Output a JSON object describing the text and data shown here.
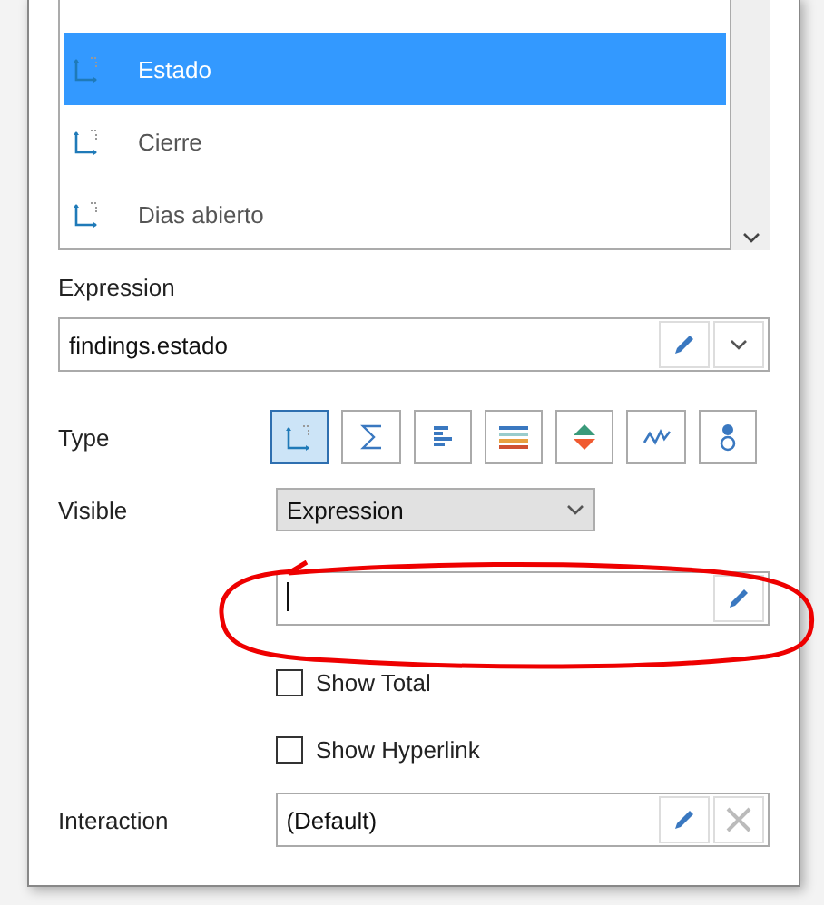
{
  "field_list": {
    "items": [
      {
        "label": "Estado",
        "selected": true
      },
      {
        "label": "Cierre",
        "selected": false
      },
      {
        "label": "Dias abierto",
        "selected": false
      }
    ]
  },
  "expression": {
    "label": "Expression",
    "value": "findings.estado"
  },
  "type": {
    "label": "Type",
    "options": [
      {
        "kind": "dimension",
        "selected": true
      },
      {
        "kind": "sum",
        "selected": false
      },
      {
        "kind": "bars",
        "selected": false
      },
      {
        "kind": "stripes",
        "selected": false
      },
      {
        "kind": "updown",
        "selected": false
      },
      {
        "kind": "sparkline",
        "selected": false
      },
      {
        "kind": "indicator",
        "selected": false
      }
    ]
  },
  "visible": {
    "label": "Visible",
    "value": "Expression"
  },
  "visible_expression": {
    "annotated": true
  },
  "checkboxes": [
    {
      "label": "Show Total",
      "checked": false
    },
    {
      "label": "Show Hyperlink",
      "checked": false
    }
  ],
  "interaction": {
    "label": "Interaction",
    "value": "(Default)"
  }
}
